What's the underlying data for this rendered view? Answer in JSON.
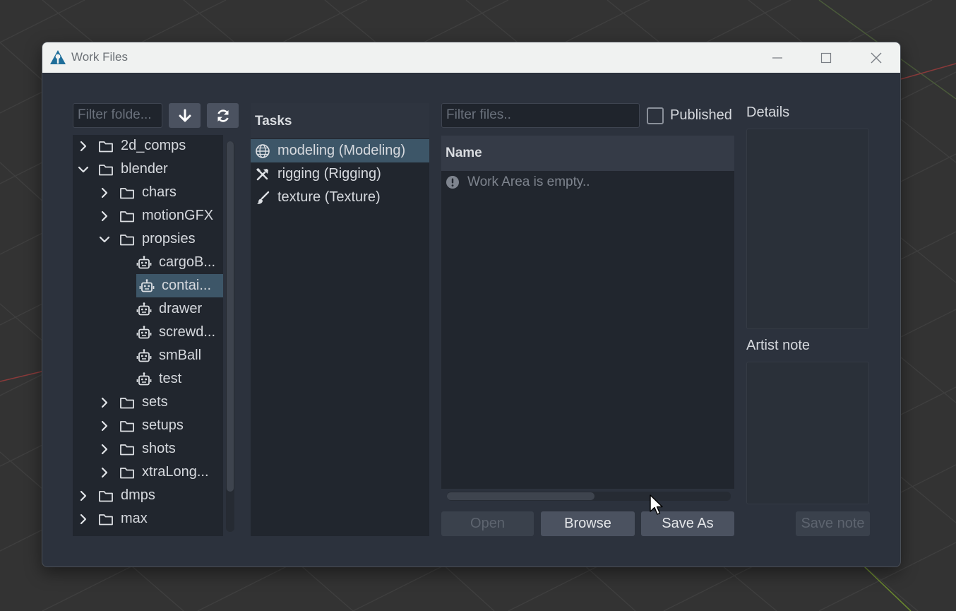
{
  "window": {
    "title": "Work Files"
  },
  "folders": {
    "filter_placeholder": "Filter folde...",
    "items": [
      {
        "label": "2d_comps",
        "expanded": false,
        "icon": "folder-icon"
      },
      {
        "label": "blender",
        "expanded": true,
        "icon": "folder-icon"
      },
      {
        "label": "chars",
        "expanded": false,
        "icon": "folder-icon"
      },
      {
        "label": "motionGFX",
        "expanded": false,
        "icon": "folder-icon"
      },
      {
        "label": "propsies",
        "expanded": true,
        "icon": "folder-icon"
      },
      {
        "label": "cargoB...",
        "icon": "asset-robot-icon"
      },
      {
        "label": "contai...",
        "icon": "asset-robot-icon",
        "selected": true
      },
      {
        "label": "drawer",
        "icon": "asset-robot-icon"
      },
      {
        "label": "screwd...",
        "icon": "asset-robot-icon"
      },
      {
        "label": "smBall",
        "icon": "asset-robot-icon"
      },
      {
        "label": "test",
        "icon": "asset-robot-icon"
      },
      {
        "label": "sets",
        "expanded": false,
        "icon": "folder-icon"
      },
      {
        "label": "setups",
        "expanded": false,
        "icon": "folder-icon"
      },
      {
        "label": "shots",
        "expanded": false,
        "icon": "folder-icon"
      },
      {
        "label": "xtraLong...",
        "expanded": false,
        "icon": "folder-icon"
      },
      {
        "label": "dmps",
        "expanded": false,
        "icon": "folder-icon"
      },
      {
        "label": "max",
        "expanded": false,
        "icon": "folder-icon"
      }
    ]
  },
  "tasks": {
    "header": "Tasks",
    "items": [
      {
        "label": "modeling (Modeling)",
        "icon": "globe-icon",
        "selected": true
      },
      {
        "label": "rigging (Rigging)",
        "icon": "tools-icon"
      },
      {
        "label": "texture (Texture)",
        "icon": "brush-icon"
      }
    ]
  },
  "files": {
    "filter_placeholder": "Filter files..",
    "published_label": "Published",
    "published_checked": false,
    "column_name": "Name",
    "empty_message": "Work Area is empty..",
    "scroll_fraction": 0.52
  },
  "buttons": {
    "open": "Open",
    "browse": "Browse",
    "save_as": "Save As",
    "save_note": "Save note"
  },
  "side": {
    "details_label": "Details",
    "artist_note_label": "Artist note"
  },
  "colors": {
    "accent_selected": "#3d5668",
    "window_bg": "#2c323d",
    "panel_bg": "#21262e",
    "titlebar_bg": "#f0f2f1"
  }
}
